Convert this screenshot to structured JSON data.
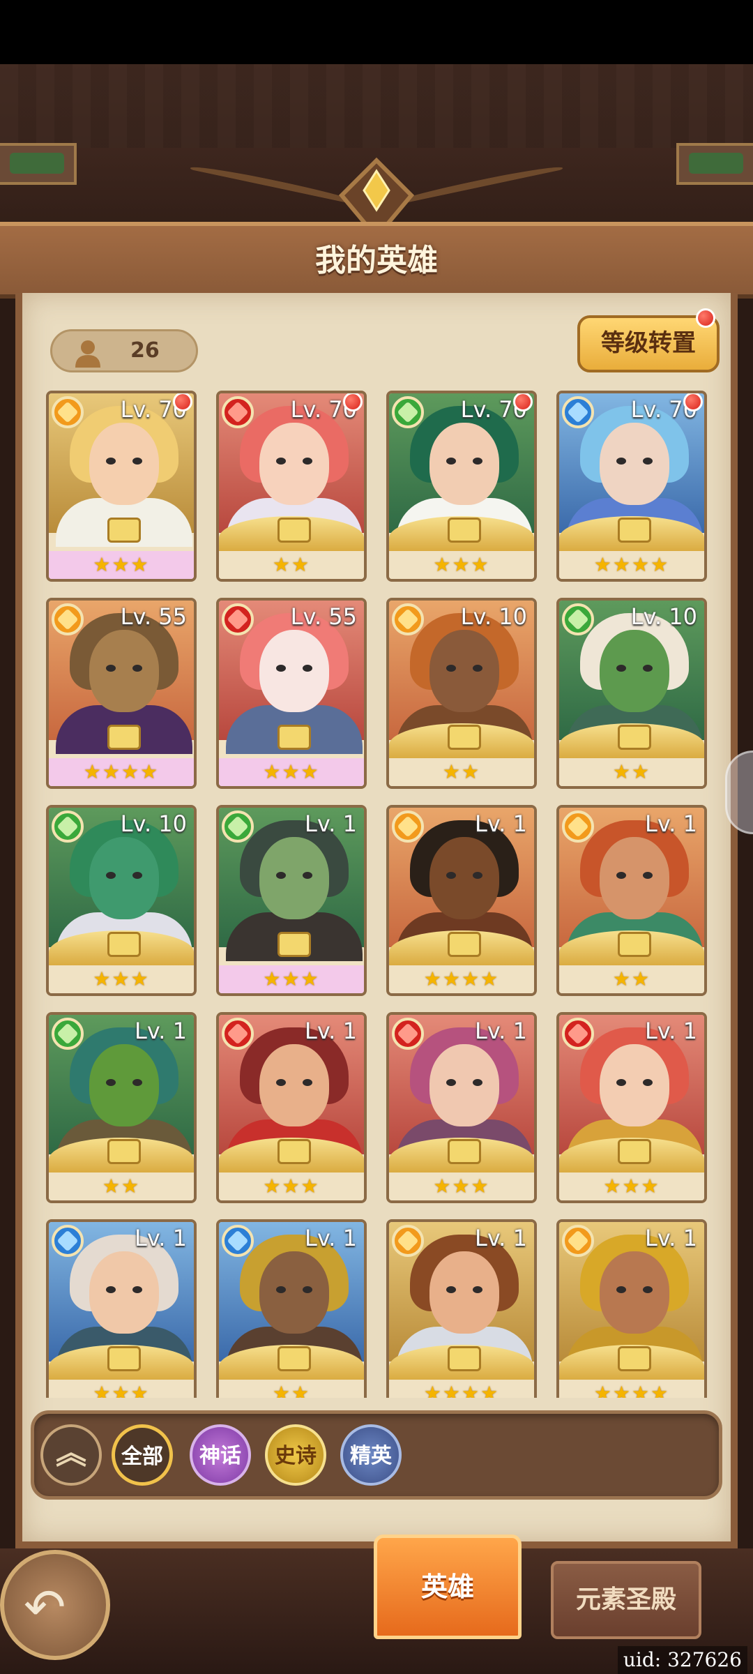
{
  "header": {
    "title": "我的英雄"
  },
  "hero_count": "26",
  "level_transfer_button": "等级转置",
  "heroes": [
    {
      "level": "Lv. 70",
      "element": "fire",
      "stars": "★★★",
      "frame": "wing",
      "bg": "bg-light",
      "hair": "#f0cc72",
      "skin": "#f5cfae",
      "cloth": "#f2f0e6",
      "reddot": true
    },
    {
      "level": "Lv. 70",
      "element": "red",
      "stars": "★★",
      "frame": "gold",
      "bg": "bg-red",
      "hair": "#ea6b64",
      "skin": "#f7d2bc",
      "cloth": "#e9e4f0",
      "reddot": true
    },
    {
      "level": "Lv. 70",
      "element": "wind",
      "stars": "★★★",
      "frame": "gold",
      "bg": "bg-wind",
      "hair": "#1f6b4c",
      "skin": "#f2cdb2",
      "cloth": "#f5f5f0",
      "reddot": true
    },
    {
      "level": "Lv. 70",
      "element": "water",
      "stars": "★★★★",
      "frame": "gold",
      "bg": "bg-water",
      "hair": "#7fc3ea",
      "skin": "#efd4c2",
      "cloth": "#5b7fd1",
      "reddot": true
    },
    {
      "level": "Lv. 55",
      "element": "fire",
      "stars": "★★★★",
      "frame": "wing",
      "bg": "bg-fire",
      "hair": "#7a5a36",
      "skin": "#a77f4e",
      "cloth": "#4b2d60",
      "reddot": false
    },
    {
      "level": "Lv. 55",
      "element": "red",
      "stars": "★★★",
      "frame": "wing",
      "bg": "bg-red",
      "hair": "#f07b76",
      "skin": "#f8e6e2",
      "cloth": "#5a6e98",
      "reddot": false
    },
    {
      "level": "Lv. 10",
      "element": "fire",
      "stars": "★★",
      "frame": "gold",
      "bg": "bg-fire",
      "hair": "#c4682a",
      "skin": "#8a5a3a",
      "cloth": "#7a4a2a",
      "reddot": false
    },
    {
      "level": "Lv. 10",
      "element": "wind",
      "stars": "★★",
      "frame": "gold",
      "bg": "bg-wind",
      "hair": "#efe6d6",
      "skin": "#5d9a4e",
      "cloth": "#3f6a56",
      "reddot": false
    },
    {
      "level": "Lv. 10",
      "element": "wind",
      "stars": "★★★",
      "frame": "gold",
      "bg": "bg-wind",
      "hair": "#2f8a5a",
      "skin": "#3f9a6e",
      "cloth": "#e0e0e8",
      "reddot": false
    },
    {
      "level": "Lv. 1",
      "element": "wind",
      "stars": "★★★",
      "frame": "wing",
      "bg": "bg-wind",
      "hair": "#3a4a40",
      "skin": "#7fa56a",
      "cloth": "#3a3430",
      "reddot": false
    },
    {
      "level": "Lv. 1",
      "element": "fire",
      "stars": "★★★★",
      "frame": "gold",
      "bg": "bg-fire",
      "hair": "#2a2018",
      "skin": "#7a4a2a",
      "cloth": "#6e3a22",
      "reddot": false
    },
    {
      "level": "Lv. 1",
      "element": "fire",
      "stars": "★★",
      "frame": "gold",
      "bg": "bg-fire",
      "hair": "#c8552a",
      "skin": "#d6946a",
      "cloth": "#3c8a66",
      "reddot": false
    },
    {
      "level": "Lv. 1",
      "element": "wind",
      "stars": "★★",
      "frame": "gold",
      "bg": "bg-wind",
      "hair": "#2f7a6e",
      "skin": "#5f9a3a",
      "cloth": "#6a5a3a",
      "reddot": false
    },
    {
      "level": "Lv. 1",
      "element": "red",
      "stars": "★★★",
      "frame": "gold",
      "bg": "bg-red",
      "hair": "#8a2a28",
      "skin": "#e8b08a",
      "cloth": "#c8302c",
      "reddot": false
    },
    {
      "level": "Lv. 1",
      "element": "red",
      "stars": "★★★",
      "frame": "gold",
      "bg": "bg-red",
      "hair": "#b6527e",
      "skin": "#f0c8b0",
      "cloth": "#7a4a6a",
      "reddot": false
    },
    {
      "level": "Lv. 1",
      "element": "red",
      "stars": "★★★",
      "frame": "gold",
      "bg": "bg-red",
      "hair": "#e05a4a",
      "skin": "#f3cdb2",
      "cloth": "#d8a23a",
      "reddot": false
    },
    {
      "level": "Lv. 1",
      "element": "water",
      "stars": "★★★",
      "frame": "gold",
      "bg": "bg-water",
      "hair": "#e4dad0",
      "skin": "#f0c8a8",
      "cloth": "#3a5a6a",
      "reddot": false
    },
    {
      "level": "Lv. 1",
      "element": "water",
      "stars": "★★",
      "frame": "gold",
      "bg": "bg-water",
      "hair": "#c8a030",
      "skin": "#8a6040",
      "cloth": "#5a4030",
      "reddot": false
    },
    {
      "level": "Lv. 1",
      "element": "fire",
      "stars": "★★★★",
      "frame": "gold",
      "bg": "bg-light",
      "hair": "#8a4a24",
      "skin": "#e8b08a",
      "cloth": "#d8dce4",
      "reddot": false
    },
    {
      "level": "Lv. 1",
      "element": "fire",
      "stars": "★★★★",
      "frame": "gold",
      "bg": "bg-light",
      "hair": "#d8a828",
      "skin": "#b87850",
      "cloth": "#c8982a",
      "reddot": false
    }
  ],
  "element_colors": {
    "fire": {
      "ring": "#f29a1c",
      "gem": "#ffe18a"
    },
    "red": {
      "ring": "#d3231f",
      "gem": "#ff9a8a"
    },
    "wind": {
      "ring": "#3aa83a",
      "gem": "#c8f0a8"
    },
    "water": {
      "ring": "#2c7fd6",
      "gem": "#a8dcff"
    }
  },
  "filters": {
    "collapse_icon": "︽",
    "all": "全部",
    "myth": "神话",
    "epic": "史诗",
    "elite": "精英"
  },
  "bottom_tabs": {
    "hero": "英雄",
    "element_hall": "元素圣殿"
  },
  "back_icon": "↶",
  "uid": "uid: 327626"
}
